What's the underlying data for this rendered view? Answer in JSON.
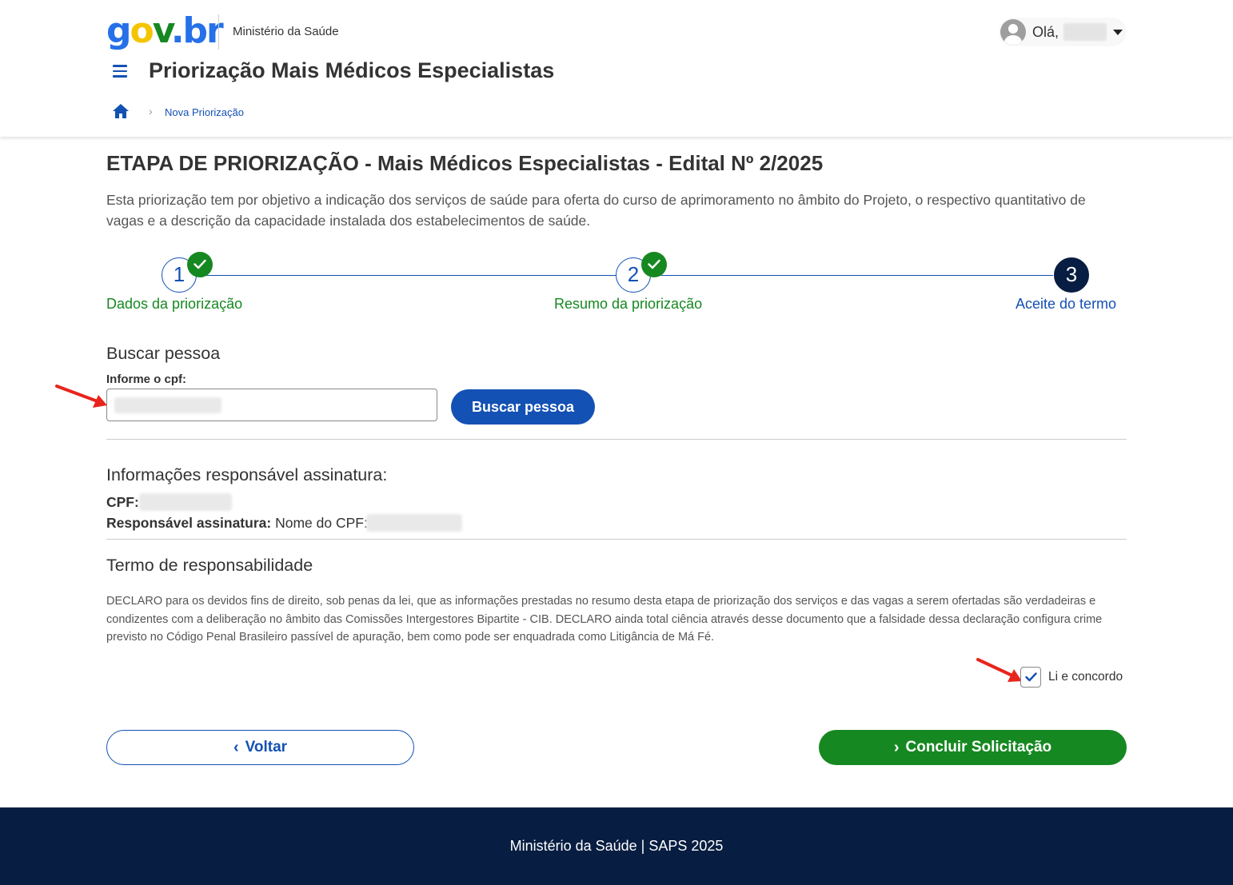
{
  "header": {
    "logo": {
      "g": "g",
      "o": "o",
      "v": "v",
      "dot": ".",
      "b": "b",
      "r": "r"
    },
    "ministry": "Ministério da Saúde",
    "greeting": "Olá,",
    "app_title": "Priorização Mais Médicos Especialistas",
    "breadcrumb": {
      "current": "Nova Priorização"
    }
  },
  "main": {
    "title": "ETAPA DE PRIORIZAÇÃO - Mais Médicos Especialistas - Edital Nº 2/2025",
    "description": "Esta priorização tem por objetivo a indicação dos serviços de saúde para oferta do curso de aprimoramento no âmbito do Projeto, o respectivo quantitativo de vagas e a descrição da capacidade instalada dos estabelecimentos de saúde.",
    "stepper": {
      "steps": [
        {
          "number": "1",
          "label": "Dados da priorização",
          "status": "done"
        },
        {
          "number": "2",
          "label": "Resumo da priorização",
          "status": "done"
        },
        {
          "number": "3",
          "label": "Aceite do termo",
          "status": "current"
        }
      ]
    },
    "search": {
      "heading": "Buscar pessoa",
      "field_label": "Informe o cpf:",
      "input_value": "",
      "button_label": "Buscar pessoa"
    },
    "signer": {
      "heading": "Informações responsável assinatura:",
      "cpf_label": "CPF:",
      "name_label": "Responsável assinatura:",
      "name_value": "Nome do CPF:"
    },
    "terms": {
      "heading": "Termo de responsabilidade",
      "text": "DECLARO para os devidos fins de direito, sob penas da lei, que as informações prestadas no resumo desta etapa de priorização dos serviços e das vagas a serem ofertadas são verdadeiras e condizentes com a deliberação no âmbito das Comissões Intergestores Bipartite - CIB. DECLARO ainda total ciência através desse documento que a falsidade dessa declaração configura crime previsto no Código Penal Brasileiro passível de apuração, bem como pode ser enquadrada como Litigância de Má Fé.",
      "agree_label": "Li e concordo",
      "agree_checked": true
    },
    "actions": {
      "back_label": "Voltar",
      "finish_label": "Concluir Solicitação"
    }
  },
  "footer": {
    "text": "Ministério da Saúde | SAPS 2025"
  },
  "colors": {
    "primary": "#1351b4",
    "success": "#168821",
    "dark": "#071d41",
    "annotation_arrow": "#e8251c"
  },
  "icons": [
    "menu-icon",
    "home-icon",
    "chevron-right-icon",
    "check-icon",
    "caret-down-icon",
    "chevron-left-icon",
    "avatar-icon"
  ]
}
